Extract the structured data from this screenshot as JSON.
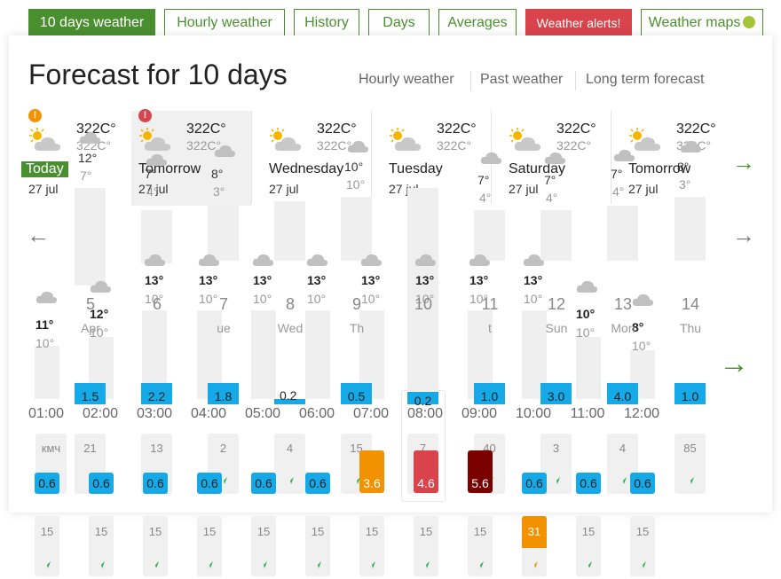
{
  "tabs": [
    {
      "label": "10 days weather",
      "active": true
    },
    {
      "label": "Hourly weather"
    },
    {
      "label": "History"
    },
    {
      "label": "Days"
    },
    {
      "label": "Averages"
    },
    {
      "label": "Weather alerts!",
      "alert": true
    },
    {
      "label": "Weather maps",
      "icon": "globe-leaf-icon"
    }
  ],
  "header": {
    "title": "Forecast for 10 days",
    "links": [
      "Hourly weather",
      "Past weather",
      "Long term forecast"
    ]
  },
  "days": [
    {
      "name": "Today",
      "date": "27 jul",
      "hi": "322C°",
      "lo": "322C°",
      "alert": "!",
      "alert_color": "#f39200",
      "today": true
    },
    {
      "name": "Tomorrow",
      "date": "27 jul",
      "hi": "322C°",
      "lo": "322C°",
      "alert": "!",
      "alert_color": "#d9434b",
      "selected": true
    },
    {
      "name": "Wednesday",
      "date": "27 jul",
      "hi": "322C°",
      "lo": "322C°"
    },
    {
      "name": "Tuesday",
      "date": "27 jul",
      "hi": "322C°",
      "lo": "322C°"
    },
    {
      "name": "Saturday",
      "date": "27 jul",
      "hi": "322C°",
      "lo": "322C°"
    },
    {
      "name": "Tomorrow",
      "date": "27 jul",
      "hi": "322C°",
      "lo": "322C°"
    }
  ],
  "upper_temps": [
    {
      "hi": "12°",
      "lo": "7°"
    },
    {
      "hi": "7°",
      "lo": "4°"
    },
    {
      "hi": "8°",
      "lo": "3°"
    },
    {
      "hi": "10°",
      "lo": "10°"
    },
    {
      "hi": "7°",
      "lo": "4°"
    },
    {
      "hi": "7°",
      "lo": "4°"
    },
    {
      "hi": "7°",
      "lo": "4°"
    },
    {
      "hi": "8°",
      "lo": "3°"
    },
    {
      "hi": "10°",
      "lo": "10°"
    },
    {
      "hi": "12°",
      "lo": "10°"
    }
  ],
  "hour_temps": [
    {
      "hi": "13°",
      "lo": "10°"
    },
    {
      "hi": "13°",
      "lo": "10°"
    },
    {
      "hi": "13°",
      "lo": "10°"
    },
    {
      "hi": "13°",
      "lo": "10°"
    },
    {
      "hi": "13°",
      "lo": "10°"
    },
    {
      "hi": "13°",
      "lo": "10°"
    },
    {
      "hi": "13°",
      "lo": "10°"
    },
    {
      "hi": "13°",
      "lo": "10°"
    }
  ],
  "lower_temps": [
    {
      "hi": "11°",
      "lo": "10°"
    },
    {
      "hi": "12°",
      "lo": "10°"
    },
    {
      "hi": "10°",
      "lo": "10°"
    },
    {
      "hi": "8°",
      "lo": "10°"
    }
  ],
  "day_axis": [
    {
      "num": "5",
      "sub": "Apr"
    },
    {
      "num": "6",
      "sub": ""
    },
    {
      "num": "7",
      "sub": "ue"
    },
    {
      "num": "8",
      "sub": "Wed"
    },
    {
      "num": "9",
      "sub": "Th"
    },
    {
      "num": "10",
      "sub": ""
    },
    {
      "num": "11",
      "sub": "t"
    },
    {
      "num": "12",
      "sub": "Sun"
    },
    {
      "num": "13",
      "sub": "Mon"
    },
    {
      "num": "14",
      "sub": "Thu"
    }
  ],
  "rain": [
    "1.5",
    "2.2",
    "1.8",
    "0.2",
    "0.5",
    "0.2",
    "1.0",
    "3.0",
    "4.0",
    "1.0"
  ],
  "hours": [
    "01:00",
    "02:00",
    "03:00",
    "04:00",
    "05:00",
    "06:00",
    "07:00",
    "08:00",
    "09:00",
    "10:00",
    "11:00",
    "12:00"
  ],
  "wind_top": [
    "кмч",
    "21",
    "13",
    "2",
    "4",
    "15",
    "7",
    "40",
    "3",
    "4",
    "85"
  ],
  "wind_values": [
    {
      "v": "0.6",
      "level": "low"
    },
    {
      "v": "0.6",
      "level": "low"
    },
    {
      "v": "0.6",
      "level": "low"
    },
    {
      "v": "0.6",
      "level": "low"
    },
    {
      "v": "0.6",
      "level": "low"
    },
    {
      "v": "0.6",
      "level": "low"
    },
    {
      "v": "3.6",
      "level": "orange"
    },
    {
      "v": "4.6",
      "level": "red"
    },
    {
      "v": "5.6",
      "level": "dark"
    },
    {
      "v": "0.6",
      "level": "low"
    },
    {
      "v": "0.6",
      "level": "low"
    },
    {
      "v": "0.6",
      "level": "low"
    }
  ],
  "gusts": [
    "15",
    "15",
    "15",
    "15",
    "15",
    "15",
    "15",
    "15",
    "15",
    "31",
    "15",
    "15"
  ],
  "colors": {
    "green": "#4a8f2f",
    "alert_red": "#d9434b",
    "orange": "#f39200",
    "rain_blue": "#16a9e7",
    "red": "#d9434b",
    "dark_red": "#7a0000"
  }
}
